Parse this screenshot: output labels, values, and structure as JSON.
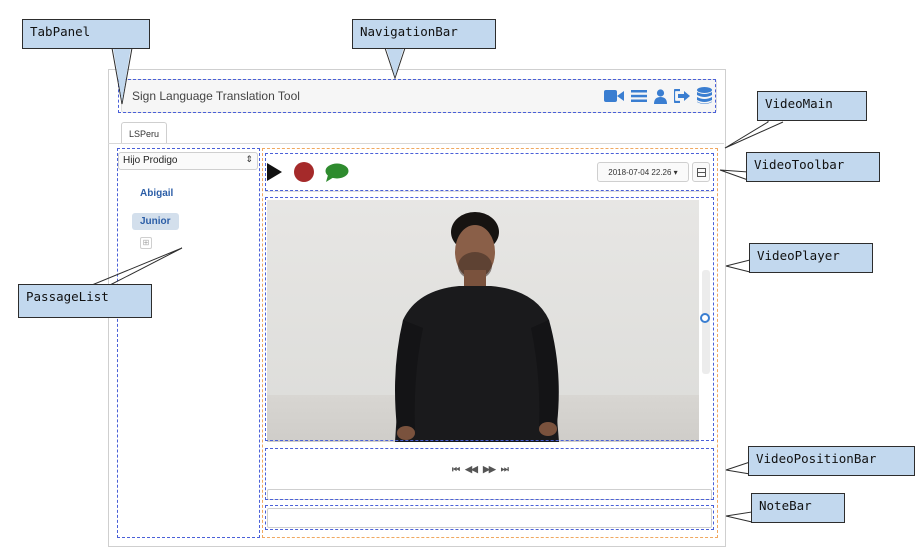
{
  "navbar": {
    "title": "Sign Language Translation Tool",
    "icons": [
      "video-camera-icon",
      "list-icon",
      "user-icon",
      "sign-out-icon",
      "database-icon"
    ],
    "icon_color": "#3a7ed1"
  },
  "tabs": [
    {
      "label": "LSPeru",
      "active": true
    }
  ],
  "passage_list": {
    "selected": "Hijo Prodigo",
    "items": [
      {
        "label": "Abigail",
        "active": false
      },
      {
        "label": "Junior",
        "active": true
      }
    ],
    "add_symbol": "⊞"
  },
  "video_toolbar": {
    "date": "2018-07-04 22.26",
    "play_color": "#111111",
    "record_color": "#a52a2a",
    "comment_color": "#2e8b2e"
  },
  "position_bar": {
    "controls": [
      "⏮",
      "◀◀",
      "▶▶",
      "⏭"
    ]
  },
  "callouts": {
    "tab_panel": "TabPanel",
    "navigation_bar": "NavigationBar",
    "video_main": "VideoMain",
    "video_toolbar": "VideoToolbar",
    "video_player": "VideoPlayer",
    "passage_list": "PassageList",
    "video_position_bar": "VideoPositionBar",
    "note_bar": "NoteBar"
  }
}
